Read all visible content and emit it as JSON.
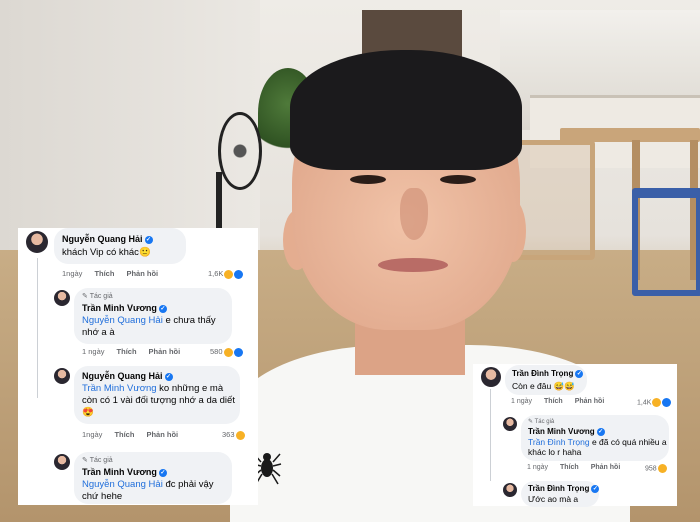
{
  "left_card": {
    "comments": [
      {
        "name": "Nguyễn Quang Hải",
        "author_tag": "",
        "mention": "",
        "text": "khách Vip có khác",
        "emoji": "🙂",
        "time": "1ngày",
        "like": "Thích",
        "reply": "Phản hồi",
        "count": "1,6K"
      },
      {
        "name": "Trần Minh Vương",
        "author_tag": "Tác giả",
        "mention": "Nguyễn Quang Hải",
        "text": " e chưa thấy nhớ a à",
        "emoji": "",
        "time": "1 ngày",
        "like": "Thích",
        "reply": "Phản hồi",
        "count": "580"
      },
      {
        "name": "Nguyễn Quang Hải",
        "author_tag": "",
        "mention": "Trần Minh Vương",
        "text": " ko những e mà còn có 1 vài đối tượng nhớ a da diết",
        "emoji": "😍",
        "time": "1ngày",
        "like": "Thích",
        "reply": "Phản hồi",
        "count": "363"
      },
      {
        "name": "Trần Minh Vương",
        "author_tag": "Tác giả",
        "mention": "Nguyễn Quang Hải",
        "text": " đc phải vậy chứ hehe",
        "emoji": "",
        "time": "",
        "like": "",
        "reply": "",
        "count": ""
      }
    ]
  },
  "right_card": {
    "comments": [
      {
        "name": "Trần Đình Trọng",
        "author_tag": "",
        "mention": "",
        "text": "Còn e đâu ",
        "emoji": "😅😅",
        "time": "1 ngày",
        "like": "Thích",
        "reply": "Phản hồi",
        "count": "1,4K"
      },
      {
        "name": "Trần Minh Vương",
        "author_tag": "Tác giả",
        "mention": "Trần Đình Trọng",
        "text": " e đã có quá nhiều a khác lo r haha",
        "emoji": "",
        "time": "1 ngày",
        "like": "Thích",
        "reply": "Phản hồi",
        "count": "958"
      },
      {
        "name": "Trần Đình Trọng",
        "author_tag": "",
        "mention": "",
        "text": "Ước ao mà a",
        "emoji": "",
        "time": "",
        "like": "",
        "reply": "",
        "count": ""
      }
    ]
  },
  "colors": {
    "mention": "#216fdb",
    "verified": "#1877f2",
    "bubble": "#f0f2f5",
    "meta": "#65676b"
  }
}
